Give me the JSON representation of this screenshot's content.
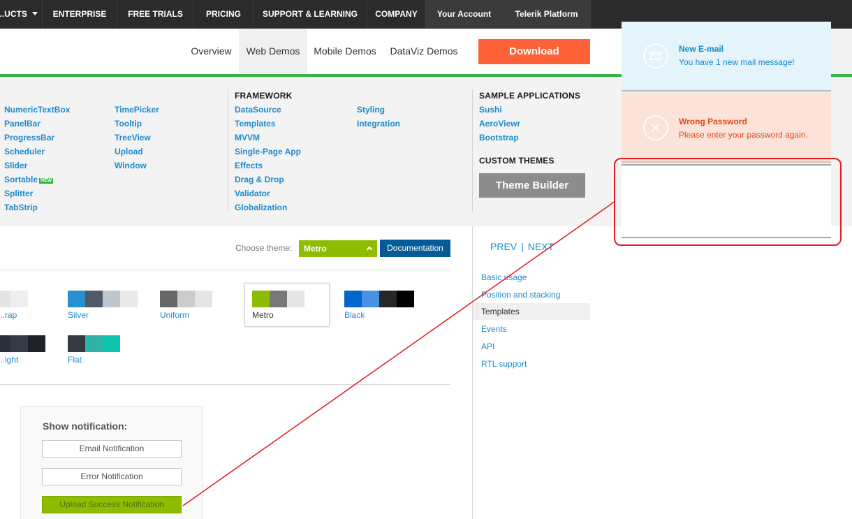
{
  "topnav": {
    "items": [
      "...UCTS",
      "ENTERPRISE",
      "FREE TRIALS",
      "PRICING",
      "SUPPORT & LEARNING",
      "COMPANY",
      "Your Account",
      "Telerik Platform"
    ]
  },
  "subnav": {
    "items": [
      "Overview",
      "Web Demos",
      "Mobile Demos",
      "DataViz Demos"
    ],
    "download": "Download"
  },
  "mega": {
    "col1": [
      "NumericTextBox",
      "PanelBar",
      "ProgressBar",
      "Scheduler",
      "Slider",
      "Sortable",
      "Splitter",
      "TabStrip"
    ],
    "new_badge": "NEW",
    "col2": [
      "TimePicker",
      "Tooltip",
      "TreeView",
      "Upload",
      "Window"
    ],
    "framework_head": "FRAMEWORK",
    "framework1": [
      "DataSource",
      "Templates",
      "MVVM",
      "Single-Page App",
      "Effects",
      "Drag & Drop",
      "Validator",
      "Globalization"
    ],
    "framework2": [
      "Styling",
      "Integration"
    ],
    "sample_head": "SAMPLE APPLICATIONS",
    "samples": [
      "Sushi",
      "AeroViewr",
      "Bootstrap"
    ],
    "custom_head": "CUSTOM THEMES",
    "theme_builder": "Theme Builder"
  },
  "themes": {
    "choose_label": "Choose theme:",
    "selected": "Metro",
    "documentation": "Documentation",
    "row1": [
      {
        "name": "...rap",
        "colors": [
          "#74b3ea",
          "#e4e4e4",
          "#efefef",
          "#ffffff"
        ]
      },
      {
        "name": "Silver",
        "colors": [
          "#298fce",
          "#515967",
          "#bfc4cd",
          "#e9e9e9"
        ]
      },
      {
        "name": "Uniform",
        "colors": [
          "#666666",
          "#cccccc",
          "#e5e5e5",
          "#ffffff"
        ]
      },
      {
        "name": "Metro",
        "colors": [
          "#8ebc00",
          "#787878",
          "#e5e5e5",
          "#ffffff"
        ]
      },
      {
        "name": "Black",
        "colors": [
          "#0066cc",
          "#4a90e2",
          "#272727",
          "#000000"
        ]
      }
    ],
    "row2": [
      {
        "name": "...ight",
        "colors": [
          "#4d5261",
          "#2b2f3a",
          "#353a47",
          "#1f222a"
        ]
      },
      {
        "name": "Flat",
        "colors": [
          "#363940",
          "#2eb3a6",
          "#10c4b2",
          "#ffffff"
        ]
      }
    ]
  },
  "sidebar": {
    "prev": "PREV",
    "sep": "|",
    "next": "NEXT",
    "links": [
      "Basic usage",
      "Position and stacking",
      "Templates",
      "Events",
      "API",
      "RTL support"
    ]
  },
  "demo": {
    "title": "Show notification:",
    "buttons": [
      "Email Notification",
      "Error Notification",
      "Upload Success Notification"
    ]
  },
  "notifications": {
    "mail_title": "New E-mail",
    "mail_text": "You have 1 new mail message!",
    "err_title": "Wrong Password",
    "err_text": "Please enter your password again."
  }
}
